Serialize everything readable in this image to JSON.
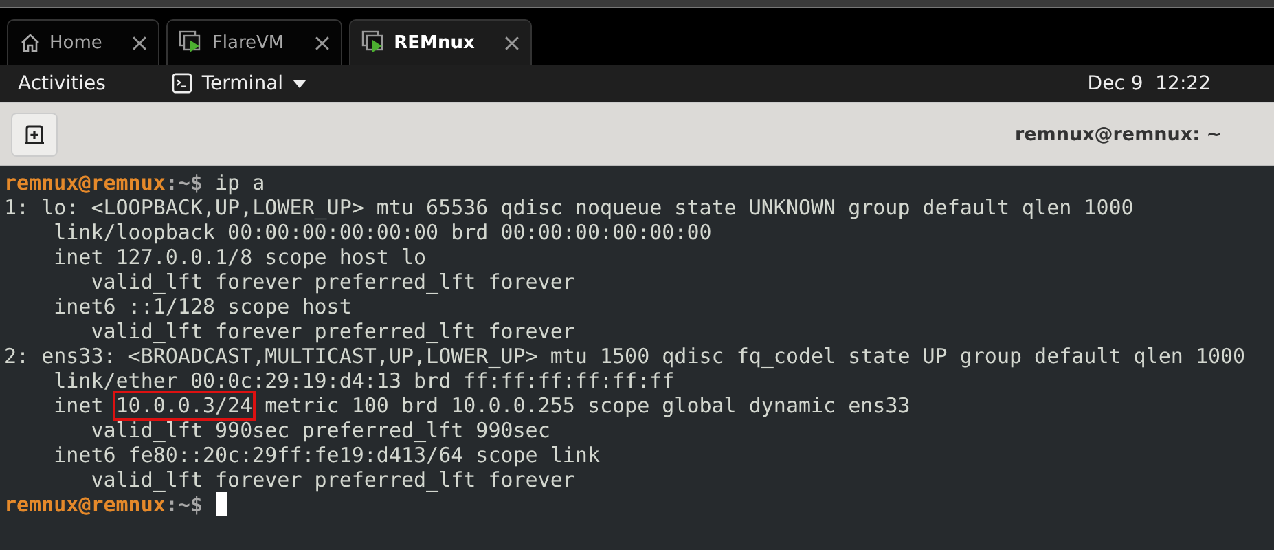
{
  "tabs": [
    {
      "label": "Home",
      "selected": false
    },
    {
      "label": "FlareVM",
      "selected": false
    },
    {
      "label": "REMnux",
      "selected": true
    }
  ],
  "top_bar": {
    "activities": "Activities",
    "app_menu": "Terminal",
    "clock": "Dec 9  12:22"
  },
  "header_bar": {
    "title": "remnux@remnux: ~"
  },
  "terminal": {
    "lines": [
      {
        "kind": "prompt",
        "user": "remnux@remnux",
        "path": ":~$",
        "command": " ip a"
      },
      {
        "kind": "output",
        "text": "1: lo: <LOOPBACK,UP,LOWER_UP> mtu 65536 qdisc noqueue state UNKNOWN group default qlen 1000"
      },
      {
        "kind": "output",
        "text": "    link/loopback 00:00:00:00:00:00 brd 00:00:00:00:00:00"
      },
      {
        "kind": "output",
        "text": "    inet 127.0.0.1/8 scope host lo"
      },
      {
        "kind": "output",
        "text": "       valid_lft forever preferred_lft forever"
      },
      {
        "kind": "output",
        "text": "    inet6 ::1/128 scope host"
      },
      {
        "kind": "output",
        "text": "       valid_lft forever preferred_lft forever"
      },
      {
        "kind": "output",
        "text": "2: ens33: <BROADCAST,MULTICAST,UP,LOWER_UP> mtu 1500 qdisc fq_codel state UP group default qlen 1000"
      },
      {
        "kind": "output",
        "text": "    link/ether 00:0c:29:19:d4:13 brd ff:ff:ff:ff:ff:ff"
      },
      {
        "kind": "marked",
        "before": "    inet ",
        "marked": "10.0.0.3/24",
        "after": " metric 100 brd 10.0.0.255 scope global dynamic ens33"
      },
      {
        "kind": "output",
        "text": "       valid_lft 990sec preferred_lft 990sec"
      },
      {
        "kind": "output",
        "text": "    inet6 fe80::20c:29ff:fe19:d413/64 scope link"
      },
      {
        "kind": "output",
        "text": "       valid_lft forever preferred_lft forever"
      },
      {
        "kind": "prompt",
        "user": "remnux@remnux",
        "path": ":~$"
      }
    ]
  }
}
